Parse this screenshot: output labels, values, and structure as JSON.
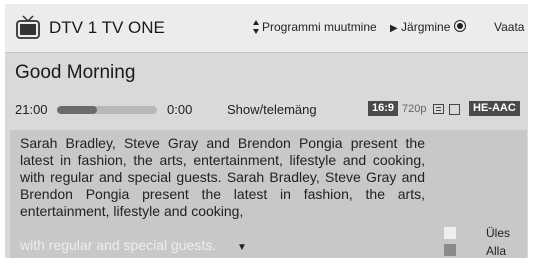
{
  "header": {
    "channel": "DTV 1 TV ONE",
    "change_programme": "Programmi muutmine",
    "next": "Järgmine",
    "view": "Vaata"
  },
  "programme": {
    "title": "Good Morning",
    "start_time": "21:00",
    "end_time": "0:00",
    "progress": 0.4,
    "genre": "Show/telemäng",
    "aspect": "16:9",
    "resolution": "720p",
    "audio": "HE-AAC"
  },
  "description": {
    "text": "Sarah Bradley, Steve Gray and Brendon Pongia present the latest in fashion, the arts, entertainment, lifestyle and cooking, with regular and special guests. Sarah Bradley, Steve Gray and Brendon Pongia present the latest in fashion, the arts, entertainment, lifestyle and cooking,",
    "faded_line": "with regular and special guests."
  },
  "legend": {
    "up": "Üles",
    "down": "Alla"
  },
  "colors": {
    "panel": "#d9d9d9",
    "header": "#ececec",
    "description_bg": "#c8c8c8",
    "badge": "#4a4a4a"
  },
  "icons": {
    "channel": "tv-icon",
    "change_programme": "up-down-arrows-icon",
    "next": "play-icon",
    "record": "radio-dot-icon",
    "subtitle": "subtitle-icon",
    "scroll": "down-arrow-icon"
  }
}
